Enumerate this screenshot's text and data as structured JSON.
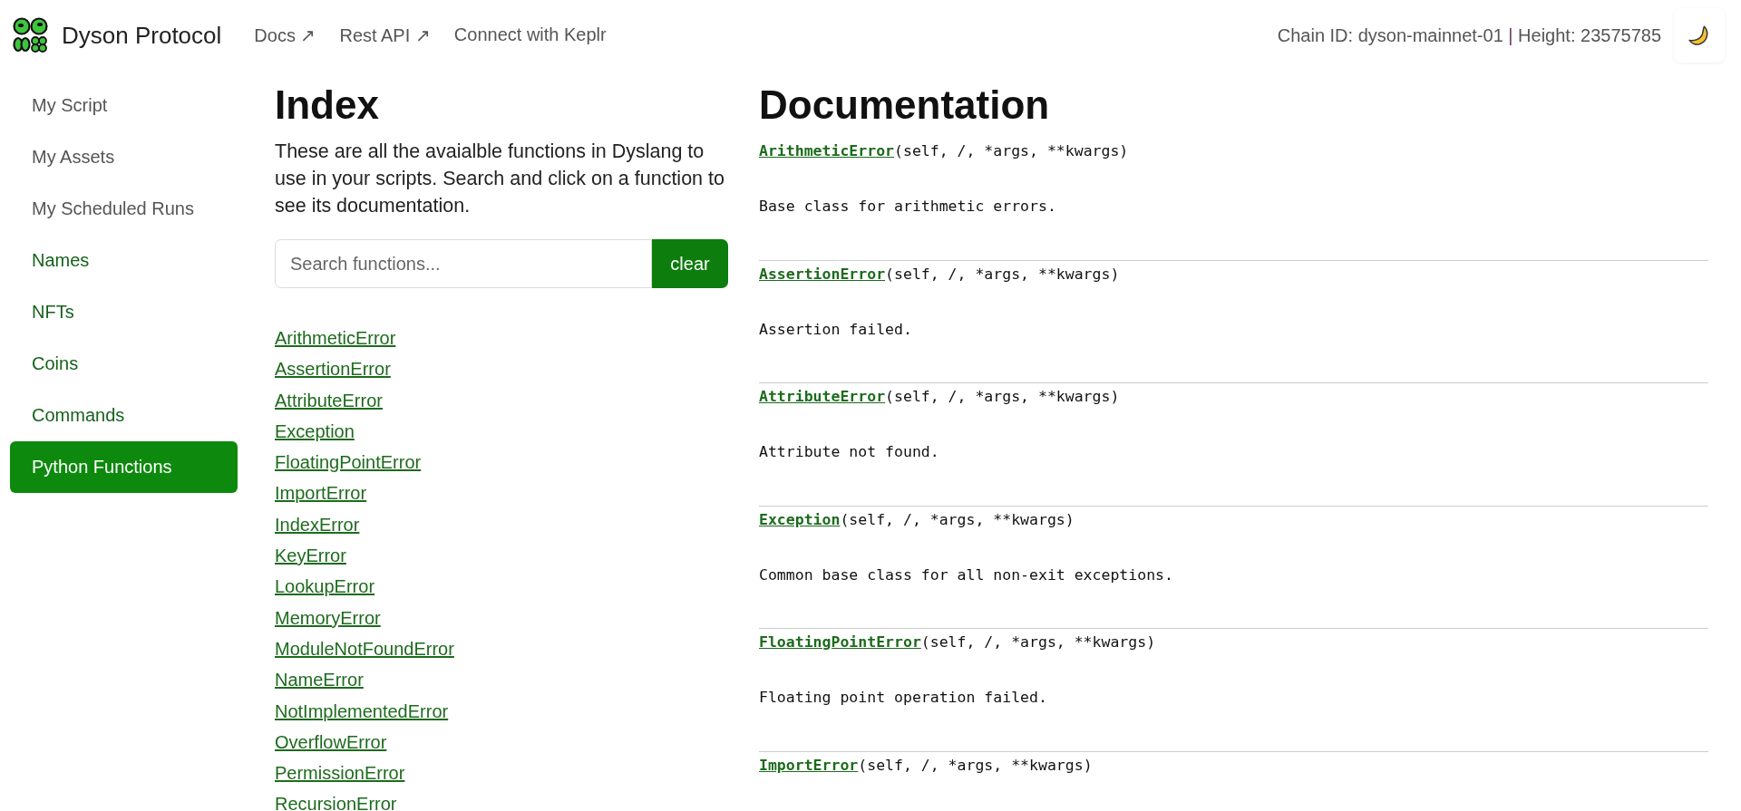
{
  "header": {
    "brand": "Dyson Protocol",
    "nav": [
      {
        "label": "Docs",
        "arrow": "↗"
      },
      {
        "label": "Rest API",
        "arrow": "↗"
      },
      {
        "label": "Connect with Keplr"
      }
    ],
    "chain_label": "Chain ID: dyson-mainnet-01",
    "separator": "|",
    "height_label": "Height: 23575785"
  },
  "sidebar": {
    "items": [
      {
        "label": "My Script",
        "kind": "account",
        "selected": false
      },
      {
        "label": "My Assets",
        "kind": "account",
        "selected": false
      },
      {
        "label": "My Scheduled Runs",
        "kind": "account",
        "selected": false
      },
      {
        "label": "Names",
        "kind": "module",
        "selected": false
      },
      {
        "label": "NFTs",
        "kind": "module",
        "selected": false
      },
      {
        "label": "Coins",
        "kind": "module",
        "selected": false
      },
      {
        "label": "Commands",
        "kind": "module",
        "selected": false
      },
      {
        "label": "Python Functions",
        "kind": "module",
        "selected": true
      }
    ]
  },
  "index": {
    "title": "Index",
    "intro": "These are all the avaialble functions in Dyslang to use in your scripts. Search and click on a function to see its documentation.",
    "search": {
      "placeholder": "Search functions..."
    },
    "clear_button": "clear",
    "functions": [
      "ArithmeticError",
      "AssertionError",
      "AttributeError",
      "Exception",
      "FloatingPointError",
      "ImportError",
      "IndexError",
      "KeyError",
      "LookupError",
      "MemoryError",
      "ModuleNotFoundError",
      "NameError",
      "NotImplementedError",
      "OverflowError",
      "PermissionError",
      "RecursionError"
    ]
  },
  "documentation": {
    "title": "Documentation",
    "entries": [
      {
        "name": "ArithmeticError",
        "signature": "(self, /, *args, **kwargs)",
        "description": "Base class for arithmetic errors."
      },
      {
        "name": "AssertionError",
        "signature": "(self, /, *args, **kwargs)",
        "description": "Assertion failed."
      },
      {
        "name": "AttributeError",
        "signature": "(self, /, *args, **kwargs)",
        "description": "Attribute not found."
      },
      {
        "name": "Exception",
        "signature": "(self, /, *args, **kwargs)",
        "description": "Common base class for all non-exit exceptions."
      },
      {
        "name": "FloatingPointError",
        "signature": "(self, /, *args, **kwargs)",
        "description": "Floating point operation failed."
      },
      {
        "name": "ImportError",
        "signature": "(self, /, *args, **kwargs)"
      }
    ]
  }
}
